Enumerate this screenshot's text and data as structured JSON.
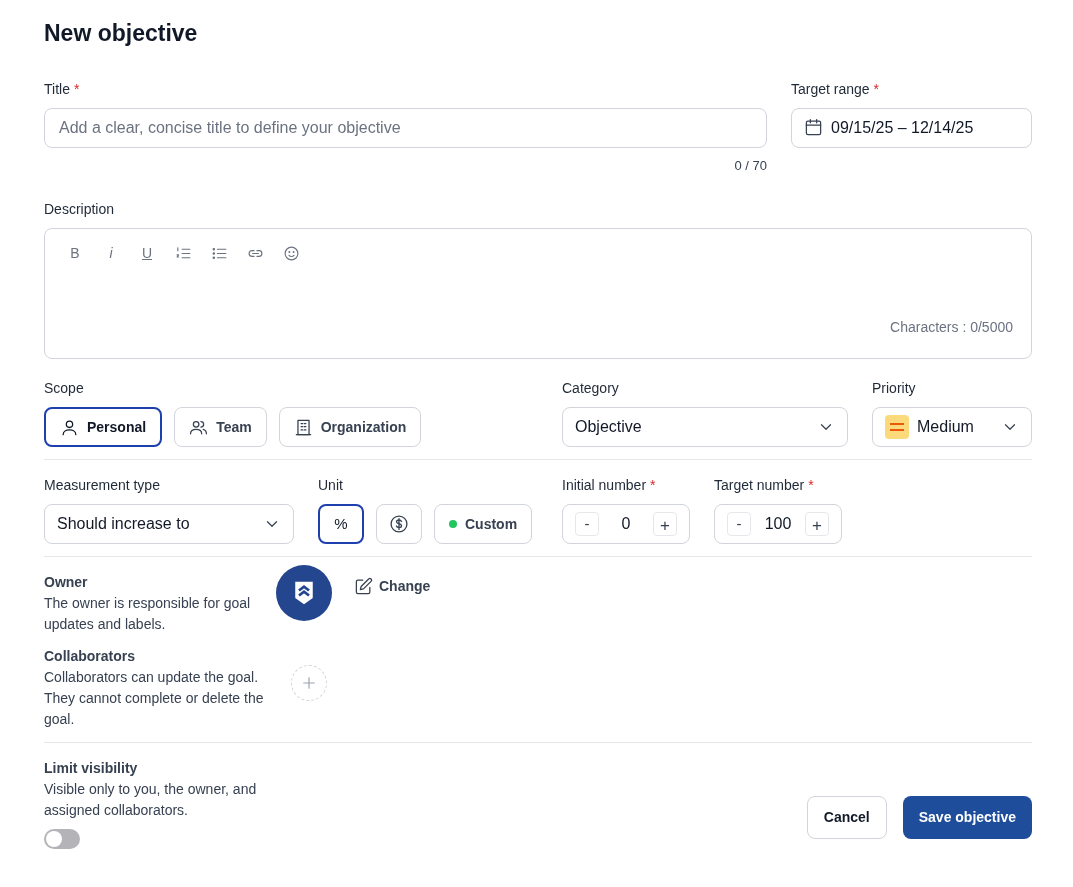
{
  "heading": "New objective",
  "title_field": {
    "label": "Title",
    "required_mark": "*",
    "placeholder": "Add a clear, concise title to define your objective",
    "counter": "0 / 70"
  },
  "target_range": {
    "label": "Target range",
    "required_mark": "*",
    "value": "09/15/25 – 12/14/25"
  },
  "description": {
    "label": "Description",
    "toolbar": [
      {
        "kind": "bold",
        "label": "B"
      },
      {
        "kind": "italic",
        "label": "i"
      },
      {
        "kind": "underline",
        "label": "U"
      },
      {
        "kind": "ordered-list"
      },
      {
        "kind": "bullet-list"
      },
      {
        "kind": "link"
      },
      {
        "kind": "emoji"
      }
    ],
    "counter": "Characters : 0/5000"
  },
  "scope": {
    "label": "Scope",
    "options": [
      {
        "kind": "person",
        "label": "Personal",
        "selected": true
      },
      {
        "kind": "team",
        "label": "Team",
        "selected": false
      },
      {
        "kind": "organization",
        "label": "Organization",
        "selected": false
      }
    ]
  },
  "category": {
    "label": "Category",
    "value": "Objective"
  },
  "priority": {
    "label": "Priority",
    "value": "Medium"
  },
  "measurement_type": {
    "label": "Measurement type",
    "value": "Should increase to"
  },
  "unit": {
    "label": "Unit",
    "options": [
      {
        "kind": "percent",
        "label": "%",
        "selected": true
      },
      {
        "kind": "dollar",
        "selected": false
      },
      {
        "kind": "custom",
        "label": "Custom",
        "selected": false,
        "color": "#22c55e"
      }
    ]
  },
  "numbers": [
    {
      "label": "Initial number",
      "required_mark": "*",
      "minus": "-",
      "value": "0",
      "plus": "+"
    },
    {
      "label": "Target number",
      "required_mark": "*",
      "minus": "-",
      "value": "100",
      "plus": "+"
    }
  ],
  "owner": {
    "label": "Owner",
    "description": "The owner is responsible for goal updates and labels.",
    "change": "Change"
  },
  "collaborators": {
    "label": "Collaborators",
    "description": "Collaborators can update the goal. They cannot complete or delete the goal."
  },
  "visibility": {
    "label": "Limit visibility",
    "description": "Visible only to you, the owner, and assigned collaborators.",
    "on": false
  },
  "buttons": [
    {
      "kind": "secondary",
      "label": "Cancel"
    },
    {
      "kind": "primary",
      "label": "Save objective"
    }
  ]
}
